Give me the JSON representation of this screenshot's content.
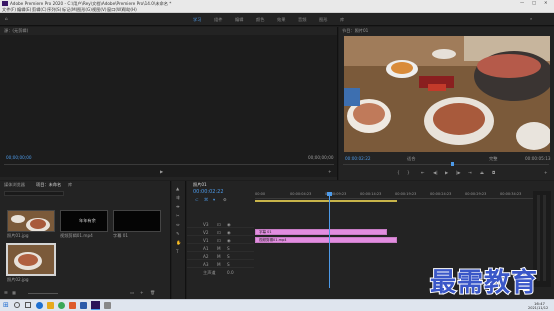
{
  "window": {
    "title": "Adobe Premiere Pro 2020 - C:\\用户\\Rey\\文档\\Adobe\\Premiere Pro\\14.0\\未命名 *"
  },
  "menu": [
    "文件(F)",
    "编辑(E)",
    "剪辑(C)",
    "序列(S)",
    "标记(M)",
    "图形(G)",
    "视图(V)",
    "窗口(W)",
    "帮助(H)"
  ],
  "workspaces": [
    "学习",
    "组件",
    "编辑",
    "颜色",
    "效果",
    "音频",
    "图形",
    "库"
  ],
  "source": {
    "tab": "源：(无剪辑)",
    "timecode_left": "00;00;00;00",
    "timecode_right": "00;00;00;00"
  },
  "program": {
    "tab": "节目：照片01",
    "timecode": "00:00:02:22",
    "fit": "适合",
    "quality": "完整",
    "duration": "00:00:05:13"
  },
  "project": {
    "tabs": [
      "项目：未命名",
      "媒体浏览器",
      "库"
    ],
    "search": "",
    "items": [
      {
        "name": "照片01.jpg",
        "duration": "5:00",
        "selected": false
      },
      {
        "name": "视频剪辑01.mp4",
        "duration": "5:00",
        "selected": false
      },
      {
        "name": "字幕 01",
        "duration": "5:00",
        "selected": false
      },
      {
        "name": "照片02.jpg",
        "duration": "5:00",
        "selected": true
      }
    ],
    "card_text": "年年有余"
  },
  "timeline": {
    "tab": "照片01",
    "timecode": "00:00:02:22",
    "ruler": [
      "00:00",
      "00:00:04:23",
      "00:00:09:23",
      "00:00:14:23",
      "00:00:19:23",
      "00:00:24:23",
      "00:00:29:23",
      "00:00:34:23"
    ],
    "tracks": [
      {
        "name": "V3",
        "clip": ""
      },
      {
        "name": "V2",
        "clip": ""
      },
      {
        "name": "V1",
        "clip": "字幕 01"
      },
      {
        "name": "A1",
        "clip": "视频剪辑01.mp4"
      },
      {
        "name": "A2",
        "clip": ""
      },
      {
        "name": "A3",
        "clip": ""
      }
    ],
    "master": "主声道",
    "master_value": "0.0"
  },
  "watermark": "最需教育",
  "taskbar": {
    "time": "16:47",
    "date": "2021/11/12"
  }
}
